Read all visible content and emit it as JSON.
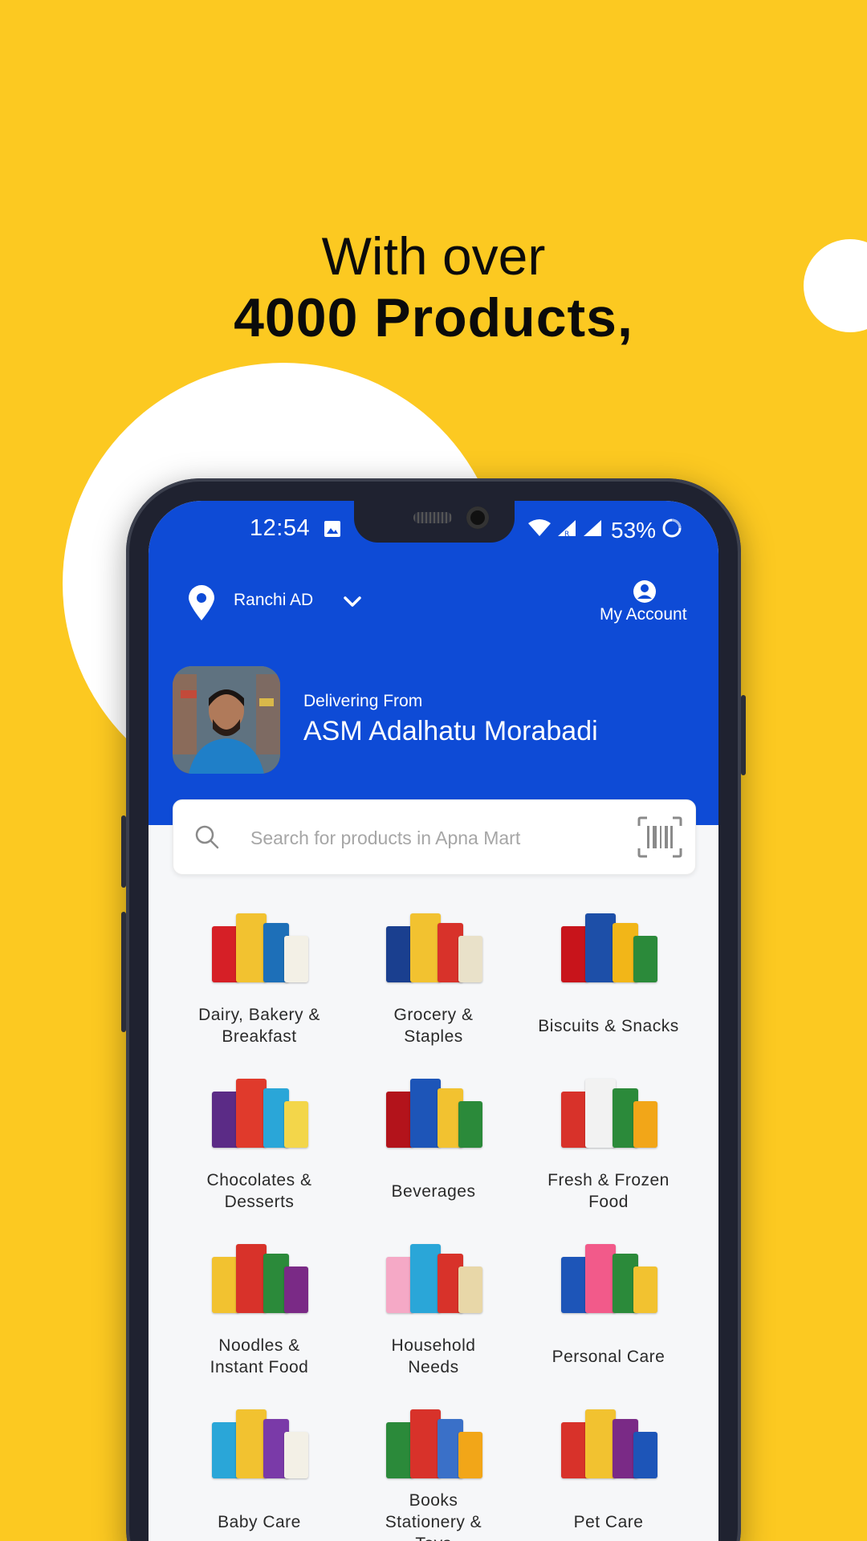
{
  "headline": {
    "line1": "With over",
    "line2": "4000 Products,"
  },
  "status_bar": {
    "time": "12:54",
    "battery": "53%"
  },
  "location": {
    "name": "Ranchi AD"
  },
  "account": {
    "label": "My Account"
  },
  "store": {
    "delivering_label": "Delivering From",
    "name": "ASM Adalhatu Morabadi"
  },
  "search": {
    "placeholder": "Search for products in Apna Mart"
  },
  "categories": [
    {
      "label": "Dairy, Bakery &\nBreakfast",
      "colors": [
        "#d61f26",
        "#f2c230",
        "#1d6fb8",
        "#f3f0e6"
      ]
    },
    {
      "label": "Grocery &\nStaples",
      "colors": [
        "#1a3f8f",
        "#f2c230",
        "#d8322a",
        "#e9e1c9"
      ]
    },
    {
      "label": "Biscuits & Snacks",
      "colors": [
        "#c8141b",
        "#1d4fa8",
        "#f2b618",
        "#2b8a3a"
      ]
    },
    {
      "label": "Chocolates &\nDesserts",
      "colors": [
        "#5b2b86",
        "#e03a2c",
        "#2aa6d8",
        "#f3d64a"
      ]
    },
    {
      "label": "Beverages",
      "colors": [
        "#b3131b",
        "#1d55b8",
        "#f2c230",
        "#2b8a3a"
      ]
    },
    {
      "label": "Fresh & Frozen\nFood",
      "colors": [
        "#d8322a",
        "#f2f2f2",
        "#2b8a3a",
        "#f2a618"
      ]
    },
    {
      "label": "Noodles &\nInstant Food",
      "colors": [
        "#f2c230",
        "#d8322a",
        "#2b8a3a",
        "#7a2a86"
      ]
    },
    {
      "label": "Household\nNeeds",
      "colors": [
        "#f5a9c6",
        "#2aa6d8",
        "#d8322a",
        "#e8d7a8"
      ]
    },
    {
      "label": "Personal Care",
      "colors": [
        "#1d55b8",
        "#f25a8a",
        "#2b8a3a",
        "#f2c230"
      ]
    },
    {
      "label": "Baby Care",
      "colors": [
        "#2aa6d8",
        "#f2c230",
        "#7a3aa8",
        "#f3f0e6"
      ]
    },
    {
      "label": "Books\nStationery &\nToys",
      "colors": [
        "#2b8a3a",
        "#d8322a",
        "#3a70c8",
        "#f2a618"
      ]
    },
    {
      "label": "Pet Care",
      "colors": [
        "#d8322a",
        "#f2c230",
        "#7a2a86",
        "#1d55b8"
      ]
    }
  ],
  "theme": {
    "background": "#FCC921",
    "primary": "#0E4BD6"
  }
}
